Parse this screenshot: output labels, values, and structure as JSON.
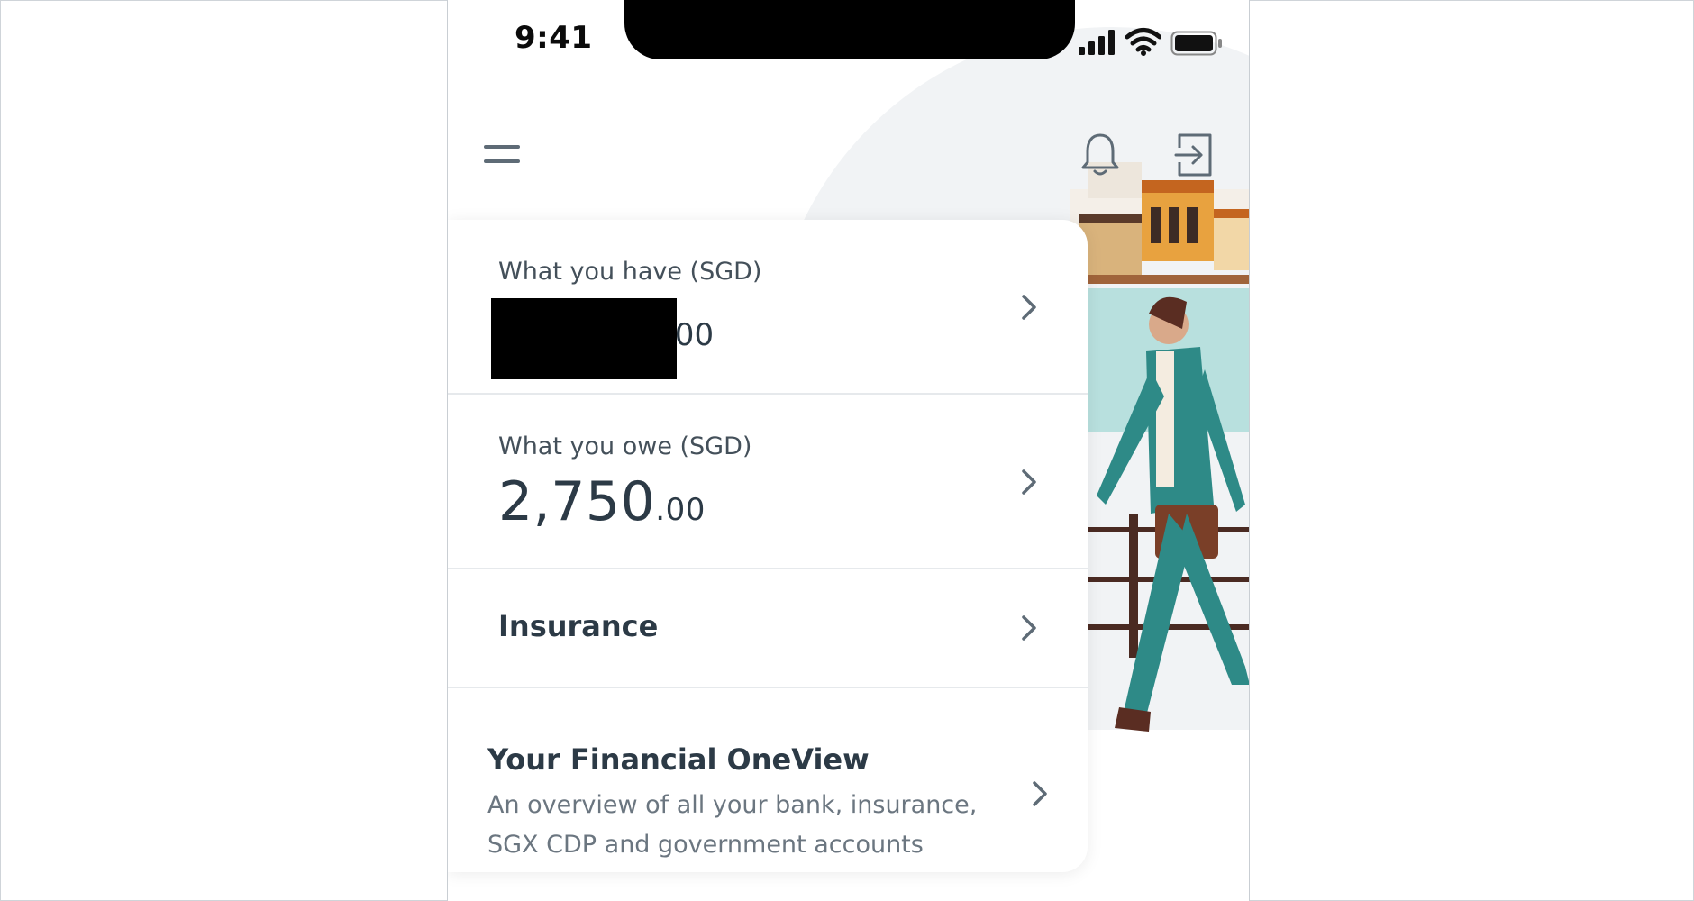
{
  "status_bar": {
    "time": "9:41"
  },
  "header": {
    "menu_icon": "hamburger-menu-icon",
    "notification_icon": "bell-icon",
    "logout_icon": "logout-icon"
  },
  "accounts": {
    "have": {
      "label": "What you have (SGD)",
      "amount_decimal": ".00"
    },
    "owe": {
      "label": "What you owe (SGD)",
      "amount_whole": "2,750",
      "amount_decimal": ".00"
    },
    "insurance": {
      "label": "Insurance"
    },
    "oneview": {
      "title": "Your Financial OneView",
      "description": "An overview of all your bank, insurance, SGX CDP and government accounts"
    }
  },
  "colors": {
    "text_primary": "#2c3a46",
    "text_secondary": "#6b7680",
    "chevron": "#5e6b76",
    "icon": "#5e6b76",
    "illustration_teal": "#2e8a87",
    "illustration_orange": "#e8a23f",
    "illustration_water": "#b8e0de"
  }
}
